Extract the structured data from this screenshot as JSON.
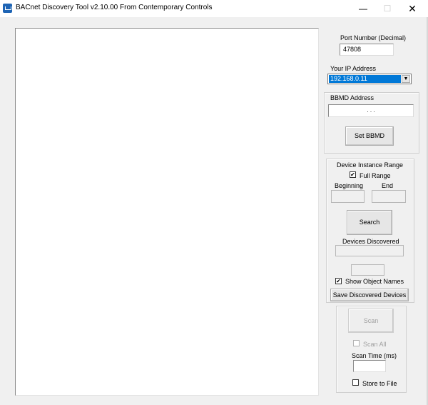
{
  "window": {
    "title": "BACnet Discovery Tool v2.10.00 From Contemporary Controls",
    "minimize": "—",
    "maximize": "☐",
    "close": "✕"
  },
  "port": {
    "label": "Port Number (Decimal)",
    "value": "47808"
  },
  "ip": {
    "label": "Your IP Address",
    "selected": "192.168.0.11",
    "arrow": "▼"
  },
  "bbmd": {
    "label": "BBMD Address",
    "dots": ".      .      .",
    "button": "Set BBMD"
  },
  "device_range": {
    "label": "Device Instance Range",
    "full_range_label": "Full Range",
    "full_range_checked": "✔",
    "beginning_label": "Beginning",
    "end_label": "End",
    "search_button": "Search",
    "devices_discovered_label": "Devices Discovered",
    "show_object_names_label": "Show Object Names",
    "show_object_names_checked": "✔",
    "save_button": "Save Discovered Devices"
  },
  "scan": {
    "scan_button": "Scan",
    "scan_all_label": "Scan All",
    "scan_time_label": "Scan Time (ms)",
    "store_to_file_label": "Store to File"
  },
  "colors": {
    "selection": "#0078d7",
    "window_bg": "#f0f0f0"
  }
}
